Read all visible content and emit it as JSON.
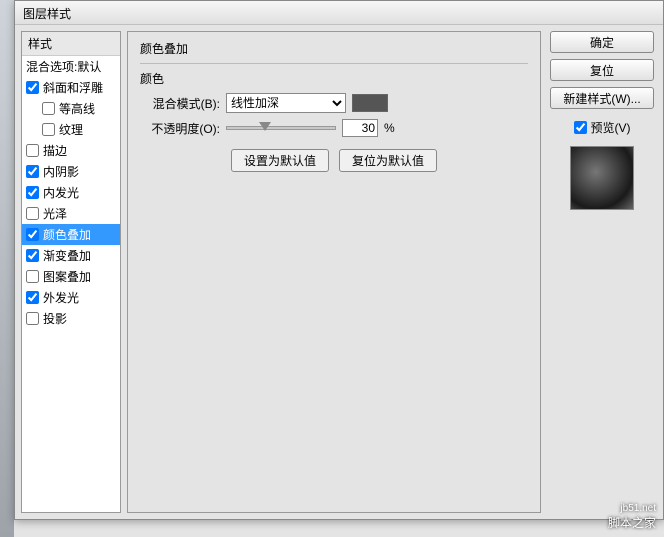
{
  "window": {
    "title": "图层样式"
  },
  "sidebar": {
    "header": "样式",
    "blendingOptions": "混合选项:默认",
    "items": [
      {
        "label": "斜面和浮雕",
        "checked": true,
        "sub": false
      },
      {
        "label": "等高线",
        "checked": false,
        "sub": true
      },
      {
        "label": "纹理",
        "checked": false,
        "sub": true
      },
      {
        "label": "描边",
        "checked": false,
        "sub": false
      },
      {
        "label": "内阴影",
        "checked": true,
        "sub": false
      },
      {
        "label": "内发光",
        "checked": true,
        "sub": false
      },
      {
        "label": "光泽",
        "checked": false,
        "sub": false
      },
      {
        "label": "颜色叠加",
        "checked": true,
        "sub": false,
        "selected": true
      },
      {
        "label": "渐变叠加",
        "checked": true,
        "sub": false
      },
      {
        "label": "图案叠加",
        "checked": false,
        "sub": false
      },
      {
        "label": "外发光",
        "checked": true,
        "sub": false
      },
      {
        "label": "投影",
        "checked": false,
        "sub": false
      }
    ]
  },
  "main": {
    "groupTitle": "颜色叠加",
    "subTitle": "颜色",
    "blendModeLabel": "混合模式(B):",
    "blendModeValue": "线性加深",
    "opacityLabel": "不透明度(O):",
    "opacityValue": "30",
    "opacityUnit": "%",
    "swatchColor": "#555555",
    "setDefault": "设置为默认值",
    "resetDefault": "复位为默认值"
  },
  "right": {
    "ok": "确定",
    "cancel": "复位",
    "newStyle": "新建样式(W)...",
    "previewLabel": "预览(V)",
    "previewChecked": true
  },
  "watermark": {
    "site": "脚本之家",
    "url": "jb51.net"
  }
}
